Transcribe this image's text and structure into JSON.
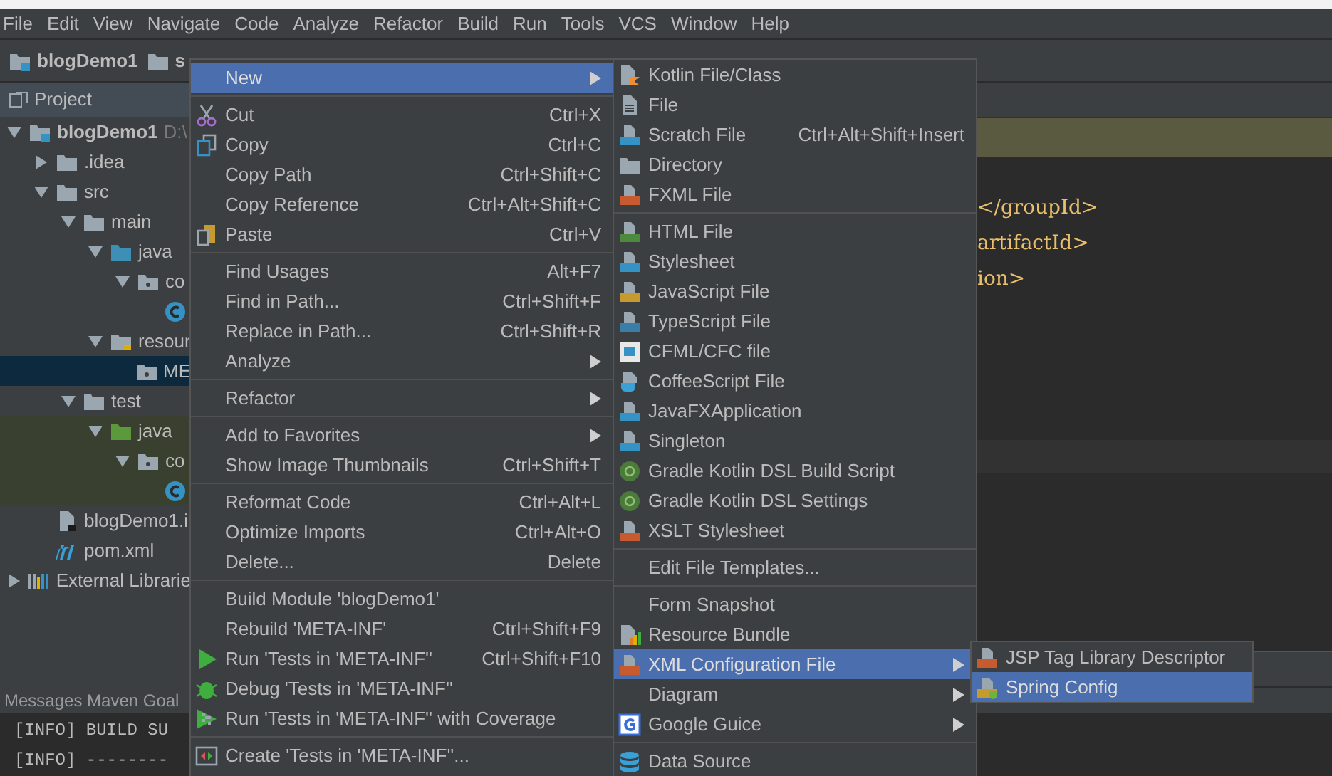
{
  "menu_bar": [
    "File",
    "Edit",
    "View",
    "Navigate",
    "Code",
    "Analyze",
    "Refactor",
    "Build",
    "Run",
    "Tools",
    "VCS",
    "Window",
    "Help"
  ],
  "breadcrumb": [
    {
      "label": "blogDemo1",
      "kind": "module"
    },
    {
      "label": "s",
      "kind": "folder"
    }
  ],
  "project_panel": {
    "title": "Project",
    "tree": [
      {
        "label": "blogDemo1",
        "detail": "D:\\",
        "kind": "module",
        "expanded": true,
        "selected": false,
        "children": [
          {
            "label": ".idea",
            "kind": "folder",
            "expanded": false,
            "selected": false
          },
          {
            "label": "src",
            "kind": "folder",
            "expanded": true,
            "selected": false,
            "children": [
              {
                "label": "main",
                "kind": "folder",
                "expanded": true,
                "selected": false,
                "children": [
                  {
                    "label": "java",
                    "kind": "source",
                    "expanded": true,
                    "selected": false,
                    "children": [
                      {
                        "label": "co",
                        "kind": "package",
                        "expanded": true,
                        "selected": false,
                        "children": [
                          {
                            "kind": "class",
                            "selected": false
                          }
                        ]
                      }
                    ]
                  },
                  {
                    "label": "resour",
                    "kind": "resources",
                    "expanded": true,
                    "selected": false,
                    "children": [
                      {
                        "label": "ME",
                        "kind": "package",
                        "selected": true
                      }
                    ]
                  }
                ]
              },
              {
                "label": "test",
                "kind": "folder",
                "expanded": true,
                "selected": false,
                "children": [
                  {
                    "label": "java",
                    "kind": "test",
                    "expanded": true,
                    "selected": false,
                    "tinted": true,
                    "children": [
                      {
                        "label": "co",
                        "kind": "package",
                        "expanded": true,
                        "selected": false,
                        "tinted": true,
                        "children": [
                          {
                            "kind": "class",
                            "selected": false,
                            "tinted": true
                          }
                        ]
                      }
                    ]
                  }
                ]
              }
            ]
          },
          {
            "label": "blogDemo1.i",
            "kind": "iml",
            "selected": false
          },
          {
            "label": "pom.xml",
            "kind": "maven",
            "selected": false
          }
        ]
      },
      {
        "label": "External Librarie",
        "kind": "libraries",
        "expanded": false,
        "selected": false
      }
    ]
  },
  "editor": {
    "lines": [
      "</groupId>",
      "artifactId>",
      "ion>"
    ]
  },
  "bottom_panel": {
    "title": "Messages Maven Goal",
    "console": [
      "[INFO] BUILD SU",
      "[INFO] --------"
    ]
  },
  "context_menu": {
    "groups": [
      [
        {
          "label": "New",
          "submenu": true,
          "selected": true
        }
      ],
      [
        {
          "label": "Cut",
          "shortcut": "Ctrl+X",
          "kind": "scissors",
          "selected": false
        },
        {
          "label": "Copy",
          "shortcut": "Ctrl+C",
          "kind": "copy",
          "selected": false
        },
        {
          "label": "Copy Path",
          "shortcut": "Ctrl+Shift+C",
          "selected": false
        },
        {
          "label": "Copy Reference",
          "shortcut": "Ctrl+Alt+Shift+C",
          "selected": false
        },
        {
          "label": "Paste",
          "shortcut": "Ctrl+V",
          "kind": "paste",
          "selected": false
        }
      ],
      [
        {
          "label": "Find Usages",
          "shortcut": "Alt+F7",
          "selected": false
        },
        {
          "label": "Find in Path...",
          "shortcut": "Ctrl+Shift+F",
          "selected": false
        },
        {
          "label": "Replace in Path...",
          "shortcut": "Ctrl+Shift+R",
          "selected": false
        },
        {
          "label": "Analyze",
          "submenu": true,
          "selected": false
        }
      ],
      [
        {
          "label": "Refactor",
          "submenu": true,
          "selected": false
        }
      ],
      [
        {
          "label": "Add to Favorites",
          "submenu": true,
          "selected": false
        },
        {
          "label": "Show Image Thumbnails",
          "shortcut": "Ctrl+Shift+T",
          "selected": false
        }
      ],
      [
        {
          "label": "Reformat Code",
          "shortcut": "Ctrl+Alt+L",
          "selected": false
        },
        {
          "label": "Optimize Imports",
          "shortcut": "Ctrl+Alt+O",
          "selected": false
        },
        {
          "label": "Delete...",
          "shortcut": "Delete",
          "selected": false
        }
      ],
      [
        {
          "label": "Build Module 'blogDemo1'",
          "selected": false
        },
        {
          "label": "Rebuild 'META-INF'",
          "shortcut": "Ctrl+Shift+F9",
          "selected": false
        },
        {
          "label": "Run 'Tests in 'META-INF''",
          "shortcut": "Ctrl+Shift+F10",
          "kind": "run",
          "selected": false
        },
        {
          "label": "Debug 'Tests in 'META-INF''",
          "kind": "debug",
          "selected": false
        },
        {
          "label": "Run 'Tests in 'META-INF'' with Coverage",
          "kind": "coverage",
          "selected": false
        }
      ],
      [
        {
          "label": "Create 'Tests in 'META-INF''...",
          "kind": "create-test",
          "selected": false
        }
      ]
    ]
  },
  "new_submenu": {
    "groups": [
      [
        {
          "label": "Kotlin File/Class",
          "kind": "kotlin",
          "selected": false
        },
        {
          "label": "File",
          "kind": "file",
          "selected": false
        },
        {
          "label": "Scratch File",
          "shortcut": "Ctrl+Alt+Shift+Insert",
          "kind": "scratch",
          "selected": false
        },
        {
          "label": "Directory",
          "kind": "folder",
          "selected": false
        },
        {
          "label": "FXML File",
          "kind": "xml",
          "selected": false
        }
      ],
      [
        {
          "label": "HTML File",
          "kind": "html",
          "selected": false
        },
        {
          "label": "Stylesheet",
          "kind": "css",
          "selected": false
        },
        {
          "label": "JavaScript File",
          "kind": "js",
          "selected": false
        },
        {
          "label": "TypeScript File",
          "kind": "ts",
          "selected": false
        },
        {
          "label": "CFML/CFC file",
          "kind": "cf",
          "selected": false
        },
        {
          "label": "CoffeeScript File",
          "kind": "coffee",
          "selected": false
        },
        {
          "label": "JavaFXApplication",
          "kind": "java",
          "selected": false
        },
        {
          "label": "Singleton",
          "kind": "java",
          "selected": false
        },
        {
          "label": "Gradle Kotlin DSL Build Script",
          "kind": "gradle",
          "selected": false
        },
        {
          "label": "Gradle Kotlin DSL Settings",
          "kind": "gradle",
          "selected": false
        },
        {
          "label": "XSLT Stylesheet",
          "kind": "xml",
          "selected": false
        }
      ],
      [
        {
          "label": "Edit File Templates...",
          "selected": false
        }
      ],
      [
        {
          "label": "Form Snapshot",
          "selected": false
        },
        {
          "label": "Resource Bundle",
          "kind": "bundle",
          "selected": false
        },
        {
          "label": "XML Configuration File",
          "kind": "xml",
          "submenu": true,
          "selected": true
        },
        {
          "label": "Diagram",
          "submenu": true,
          "selected": false
        },
        {
          "label": "Google Guice",
          "kind": "guice",
          "submenu": true,
          "selected": false
        }
      ],
      [
        {
          "label": "Data Source",
          "kind": "database",
          "selected": false
        }
      ]
    ]
  },
  "xml_submenu": {
    "groups": [
      [
        {
          "label": "JSP Tag Library Descriptor",
          "kind": "xml",
          "selected": false
        },
        {
          "label": "Spring Config",
          "kind": "spring",
          "selected": true
        }
      ]
    ]
  }
}
